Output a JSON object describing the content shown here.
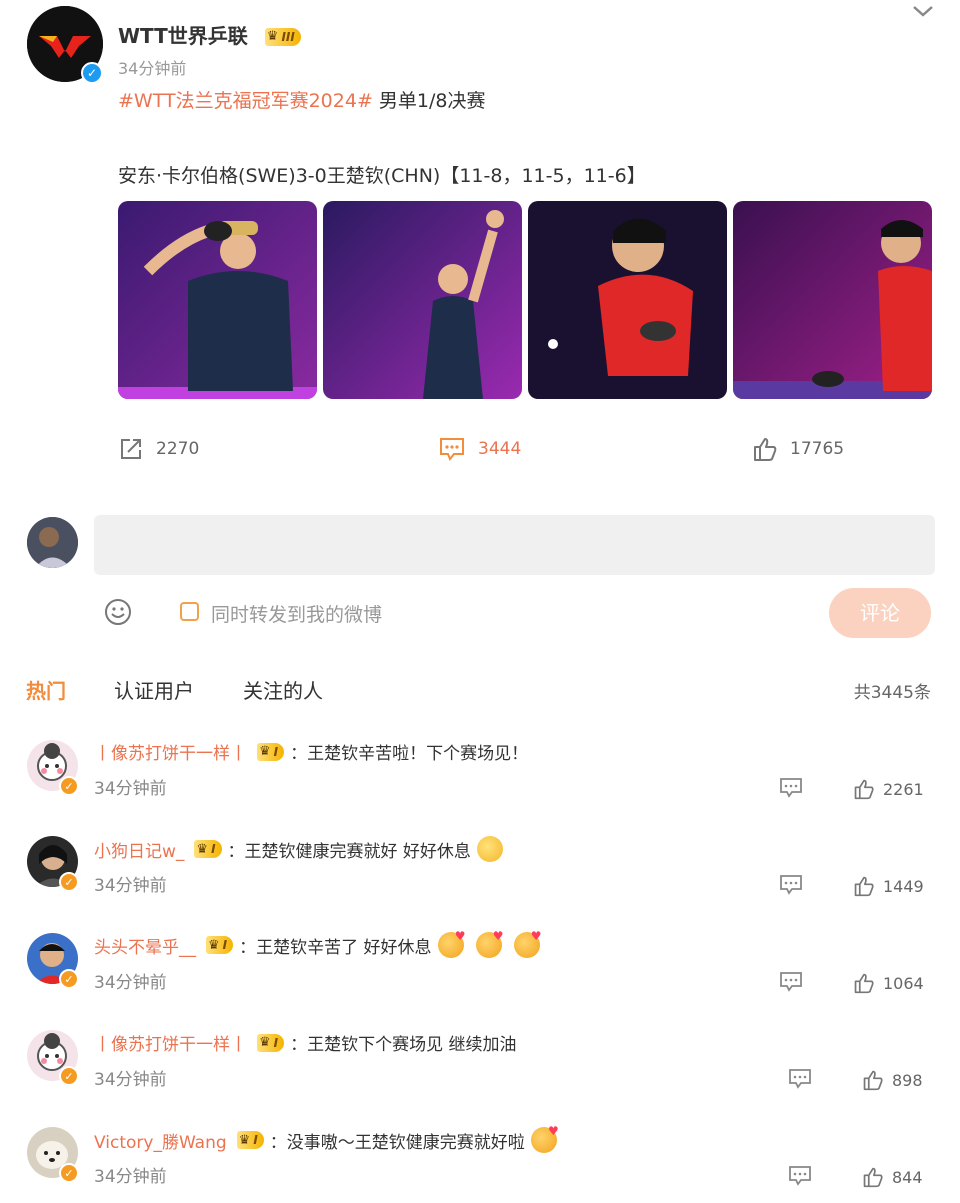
{
  "post": {
    "username": "WTT世界乒联",
    "level_label": "III",
    "verified_icon": "✓",
    "time": "34分钟前",
    "hashtag": "#WTT法兰克福冠军赛2024#",
    "title_rest": " 男单1/8决赛",
    "result": "安东·卡尔伯格(SWE)3-0王楚钦(CHN)【11-8，11-5，11-6】"
  },
  "actions": {
    "share_count": "2270",
    "comment_count": "3444",
    "like_count": "17765"
  },
  "composer": {
    "forward_label": "同时转发到我的微博",
    "submit_label": "评论",
    "input_placeholder": ""
  },
  "tabs": {
    "hot": "热门",
    "verified": "认证用户",
    "following": "关注的人",
    "total": "共3445条"
  },
  "comments": [
    {
      "name": "丨像苏打饼干一样丨",
      "level": "I",
      "text": "：王楚钦辛苦啦！下个赛场见！",
      "emoji": "",
      "time": "34分钟前",
      "likes": "2261"
    },
    {
      "name": "小狗日记w_",
      "level": "I",
      "text": "：王楚钦健康完赛就好 好好休息",
      "emoji": "hug",
      "time": "34分钟前",
      "likes": "1449"
    },
    {
      "name": "头头不晕乎__",
      "level": "I",
      "text": "：王楚钦辛苦了 好好休息",
      "emoji": "kiss3",
      "time": "34分钟前",
      "likes": "1064"
    },
    {
      "name": "丨像苏打饼干一样丨",
      "level": "I",
      "text": "：王楚钦下个赛场见 继续加油",
      "emoji": "",
      "time": "34分钟前",
      "likes": "898"
    },
    {
      "name": "Victory_勝Wang",
      "level": "I",
      "text": "：没事嗷～王楚钦健康完赛就好啦",
      "emoji": "kiss",
      "time": "34分钟前",
      "likes": "844"
    }
  ],
  "colors": {
    "accent": "#eb7350",
    "tab_active": "#f28d3c",
    "submit_bg": "#fbd2bf"
  }
}
